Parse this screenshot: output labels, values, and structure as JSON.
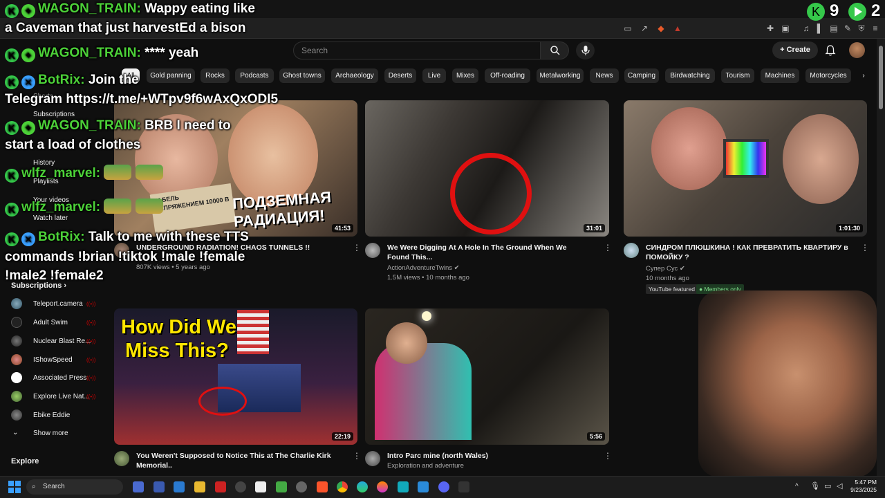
{
  "youtube": {
    "search_placeholder": "Search",
    "create_label": "Create",
    "chips": [
      "All",
      "Gold panning",
      "Rocks",
      "Podcasts",
      "Ghost towns",
      "Archaeology",
      "Deserts",
      "Live",
      "Mixes",
      "Off-roading",
      "Metalworking",
      "News",
      "Camping",
      "Birdwatching",
      "Tourism",
      "Machines",
      "Motorcycles"
    ],
    "sidebar": {
      "items": [
        "Shorts",
        "Subscriptions",
        "History",
        "Playlists",
        "Your videos",
        "Watch later"
      ],
      "subscriptions_heading": "Subscriptions",
      "subscriptions": [
        "Teleport.camera",
        "Adult Swim",
        "Nuclear Blast Re...",
        "IShowSpeed",
        "Associated Press",
        "Explore Live Nat...",
        "Ebike Eddie"
      ],
      "show_more": "Show more",
      "explore_heading": "Explore"
    },
    "videos": [
      {
        "title": "UNDERGROUND RADIATION! CHAOS TUNNELS !!",
        "channel": "",
        "meta": "807K views • 5 years ago",
        "duration": "41:53",
        "thumb_text": [
          "ПОДЗЕМНАЯ",
          "РАДИАЦИЯ!"
        ],
        "thumb_sign": "КАБЕЛЬ НАПРЯЖЕНИЕМ 10000 В"
      },
      {
        "title": "We Were Digging At A Hole In The Ground When We Found This...",
        "channel": "ActionAdventureTwins",
        "meta": "1.5M views • 10 months ago",
        "duration": "31:01"
      },
      {
        "title": "СИНДРОМ ПЛЮШКИНА ! КАК ПРЕВРАТИТЬ КВАРТИРУ в ПОМОЙКУ ?",
        "channel": "Супер Сус",
        "meta": "10 months ago",
        "duration": "1:01:30",
        "badges": [
          "YouTube featured",
          "Members only"
        ]
      },
      {
        "title": "You Weren't Supposed to Notice This at The Charlie Kirk Memorial..",
        "channel": "",
        "meta": "",
        "duration": "22:19",
        "thumb_text": [
          "How Did We",
          "Miss This?"
        ]
      },
      {
        "title": "Intro Parc mine (north Wales)",
        "channel": "Exploration and adventure",
        "meta": "",
        "duration": "5:56"
      }
    ]
  },
  "overlay": {
    "chat": [
      {
        "user": "WAGON_TRAIN:",
        "text": "Wappy eating like"
      },
      {
        "user": "",
        "text": "a Caveman that just harvestEd a bison"
      },
      {
        "user": "WAGON_TRAIN:",
        "text": "**** yeah"
      },
      {
        "user": "BotRix:",
        "text": "Join the"
      },
      {
        "user": "",
        "text": "Telegram https://t.me/+WTpv9f6wAxQxODI5"
      },
      {
        "user": "WAGON_TRAIN:",
        "text": "BRB I need to"
      },
      {
        "user": "",
        "text": "start a load of clothes"
      },
      {
        "user": "wlfz_marvel:",
        "text": ""
      },
      {
        "user": "wlfz_marvel:",
        "text": ""
      },
      {
        "user": "BotRix:",
        "text": "Talk to me with these TTS"
      },
      {
        "user": "",
        "text": "commands !brian !tiktok !male !female"
      },
      {
        "user": "",
        "text": "!male2 !female2"
      }
    ],
    "counter_left": "9",
    "counter_right": "2"
  },
  "taskbar": {
    "search_label": "Search",
    "time": "5:47 PM",
    "date": "9/23/2025"
  }
}
